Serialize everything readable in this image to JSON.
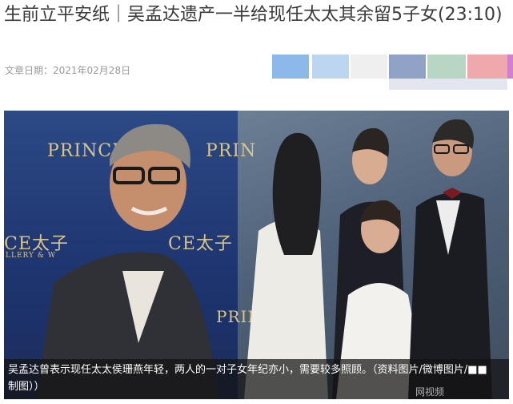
{
  "article": {
    "title": "生前立平安纸｜吴孟达遗产一半给现任太太其余留5子女(23:10)",
    "date_label": "文章日期：2021年02月28日"
  },
  "ad_swatches": [
    {
      "color": "#8db9ea"
    },
    {
      "color": "#bcd5f1"
    },
    {
      "color": "#efefef"
    },
    {
      "color": "#90a3c6"
    },
    {
      "color": "#b7d7c4"
    },
    {
      "color": "#efa9ad"
    },
    {
      "color": "#d37fd0"
    }
  ],
  "photo": {
    "logo_left": "PRINCE",
    "logo_left_sub": "JEWELLERY",
    "logo_right": "PRIN",
    "logo_mid": "CE太子",
    "logo_mid_sub": "LLERY & W",
    "logo_mid_right": "CE太子",
    "logo_bottom": "PRIN",
    "caption": "吴孟达曾表示现任太太侯珊燕年轻，两人的一对子女年纪亦小，需要较多照顾。（资料图片/微博图片/■■制图））",
    "watermark": "网视频"
  }
}
